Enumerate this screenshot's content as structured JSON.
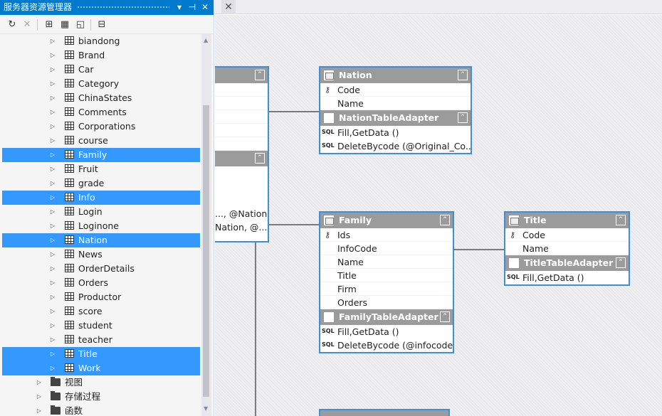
{
  "panel": {
    "title": "服务器资源管理器",
    "pin_glyph": "⊣",
    "close_glyph": "✕",
    "dropdown_glyph": "▾"
  },
  "toolbar": {
    "refresh": "↻",
    "stop": "✕",
    "connect_db": "⊞",
    "connect_server": "▦",
    "sharepoint": "◱",
    "properties": "⊟"
  },
  "tree": {
    "tables": [
      {
        "label": "biandong",
        "selected": false
      },
      {
        "label": "Brand",
        "selected": false
      },
      {
        "label": "Car",
        "selected": false
      },
      {
        "label": "Category",
        "selected": false
      },
      {
        "label": "ChinaStates",
        "selected": false
      },
      {
        "label": "Comments",
        "selected": false
      },
      {
        "label": "Corporations",
        "selected": false
      },
      {
        "label": "course",
        "selected": false
      },
      {
        "label": "Family",
        "selected": true
      },
      {
        "label": "Fruit",
        "selected": false
      },
      {
        "label": "grade",
        "selected": false
      },
      {
        "label": "Info",
        "selected": true
      },
      {
        "label": "Login",
        "selected": false
      },
      {
        "label": "Loginone",
        "selected": false
      },
      {
        "label": "Nation",
        "selected": true
      },
      {
        "label": "News",
        "selected": false
      },
      {
        "label": "OrderDetails",
        "selected": false
      },
      {
        "label": "Orders",
        "selected": false
      },
      {
        "label": "Productor",
        "selected": false
      },
      {
        "label": "score",
        "selected": false
      },
      {
        "label": "student",
        "selected": false
      },
      {
        "label": "teacher",
        "selected": false
      },
      {
        "label": "Title",
        "selected": true
      },
      {
        "label": "Work",
        "selected": true
      }
    ],
    "folders": [
      {
        "label": "视图"
      },
      {
        "label": "存储过程"
      },
      {
        "label": "函数"
      }
    ]
  },
  "tab": {
    "close_glyph": "✕"
  },
  "designer": {
    "info_partial": {
      "methods": [
        "..., @Nation...",
        "Nation, @..."
      ]
    },
    "nation": {
      "title": "Nation",
      "columns": [
        {
          "name": "Code",
          "key": true
        },
        {
          "name": "Name",
          "key": false
        }
      ],
      "adapter": "NationTableAdapter",
      "methods": [
        "Fill,GetData ()",
        "DeleteBycode (@Original_Co..."
      ]
    },
    "family": {
      "title": "Family",
      "columns": [
        {
          "name": "Ids",
          "key": true
        },
        {
          "name": "InfoCode",
          "key": false
        },
        {
          "name": "Name",
          "key": false
        },
        {
          "name": "Title",
          "key": false
        },
        {
          "name": "Firm",
          "key": false
        },
        {
          "name": "Orders",
          "key": false
        }
      ],
      "adapter": "FamilyTableAdapter",
      "methods": [
        "Fill,GetData ()",
        "DeleteBycode (@infocode)"
      ]
    },
    "title_entity": {
      "title": "Title",
      "columns": [
        {
          "name": "Code",
          "key": true
        },
        {
          "name": "Name",
          "key": false
        }
      ],
      "adapter": "TitleTableAdapter",
      "methods": [
        "Fill,GetData ()"
      ]
    },
    "sql_label": "SQL",
    "key_glyph": "⚷",
    "collapse_glyph": "⌃"
  },
  "colors": {
    "accent": "#007acc",
    "selection": "#3399ff",
    "entity_border": "#3c8fd8",
    "entity_header": "#9b9b9b"
  }
}
